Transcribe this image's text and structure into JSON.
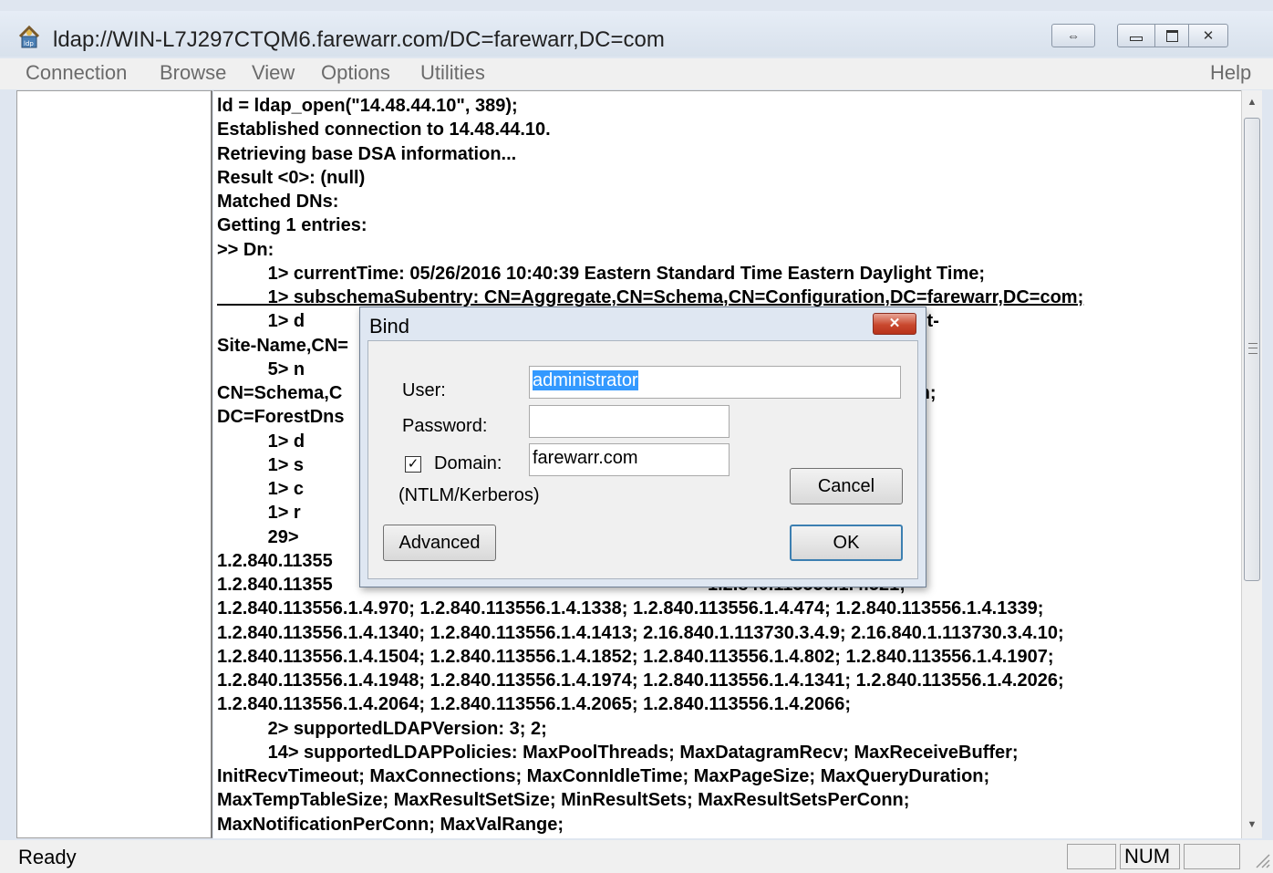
{
  "window": {
    "title": "ldap://WIN-L7J297CTQM6.farewarr.com/DC=farewarr,DC=com"
  },
  "menu": {
    "connection": "Connection",
    "browse": "Browse",
    "view": "View",
    "options": "Options",
    "utilities": "Utilities",
    "help": "Help"
  },
  "output": {
    "lines": [
      "ld = ldap_open(\"14.48.44.10\", 389);",
      "Established connection to 14.48.44.10.",
      "Retrieving base DSA information...",
      "Result <0>: (null)",
      "Matched DNs:",
      "Getting 1 entries:",
      ">> Dn:",
      "          1> currentTime: 05/26/2016 10:40:39 Eastern Standard Time Eastern Daylight Time;",
      "          1> subschemaSubentry: CN=Aggregate,CN=Schema,CN=Configuration,DC=farewarr,DC=com;",
      "          1> d                                                                         ,CN=Servers,CN=Default-First-",
      "Site-Name,CN=",
      "          5> n                                                                         C=farewarr,DC=com;",
      "CN=Schema,C                                                                          es,DC=farewarr,DC=com;",
      "DC=ForestDns",
      "          1> d",
      "          1> s                                                                         arewarr,DC=com;",
      "          1> c                                                                         DC=com;",
      "          1> r",
      "          29>                                                                          1.4.801;",
      "1.2.840.11355                                                                          1.2.840.113556.1.4.619;",
      "1.2.840.11355                                                                          1.2.840.113556.1.4.521;",
      "1.2.840.113556.1.4.970; 1.2.840.113556.1.4.1338; 1.2.840.113556.1.4.474; 1.2.840.113556.1.4.1339;",
      "1.2.840.113556.1.4.1340; 1.2.840.113556.1.4.1413; 2.16.840.1.113730.3.4.9; 2.16.840.1.113730.3.4.10;",
      "1.2.840.113556.1.4.1504; 1.2.840.113556.1.4.1852; 1.2.840.113556.1.4.802; 1.2.840.113556.1.4.1907;",
      "1.2.840.113556.1.4.1948; 1.2.840.113556.1.4.1974; 1.2.840.113556.1.4.1341; 1.2.840.113556.1.4.2026;",
      "1.2.840.113556.1.4.2064; 1.2.840.113556.1.4.2065; 1.2.840.113556.1.4.2066;",
      "          2> supportedLDAPVersion: 3; 2;",
      "          14> supportedLDAPPolicies: MaxPoolThreads; MaxDatagramRecv; MaxReceiveBuffer;",
      "InitRecvTimeout; MaxConnections; MaxConnIdleTime; MaxPageSize; MaxQueryDuration;",
      "MaxTempTableSize; MaxResultSetSize; MinResultSets; MaxResultSetsPerConn;",
      "MaxNotificationPerConn; MaxValRange;"
    ]
  },
  "status": {
    "text": "Ready",
    "num": "NUM"
  },
  "dialog": {
    "title": "Bind",
    "user_label": "User:",
    "user_value": "administrator",
    "password_label": "Password:",
    "password_value": "",
    "domain_label": "Domain:",
    "domain_checked": true,
    "domain_value": "farewarr.com",
    "auth_note": "(NTLM/Kerberos)",
    "advanced_label": "Advanced",
    "cancel_label": "Cancel",
    "ok_label": "OK"
  },
  "icons": {
    "app": "ldp-app-icon",
    "close": "close-icon"
  }
}
